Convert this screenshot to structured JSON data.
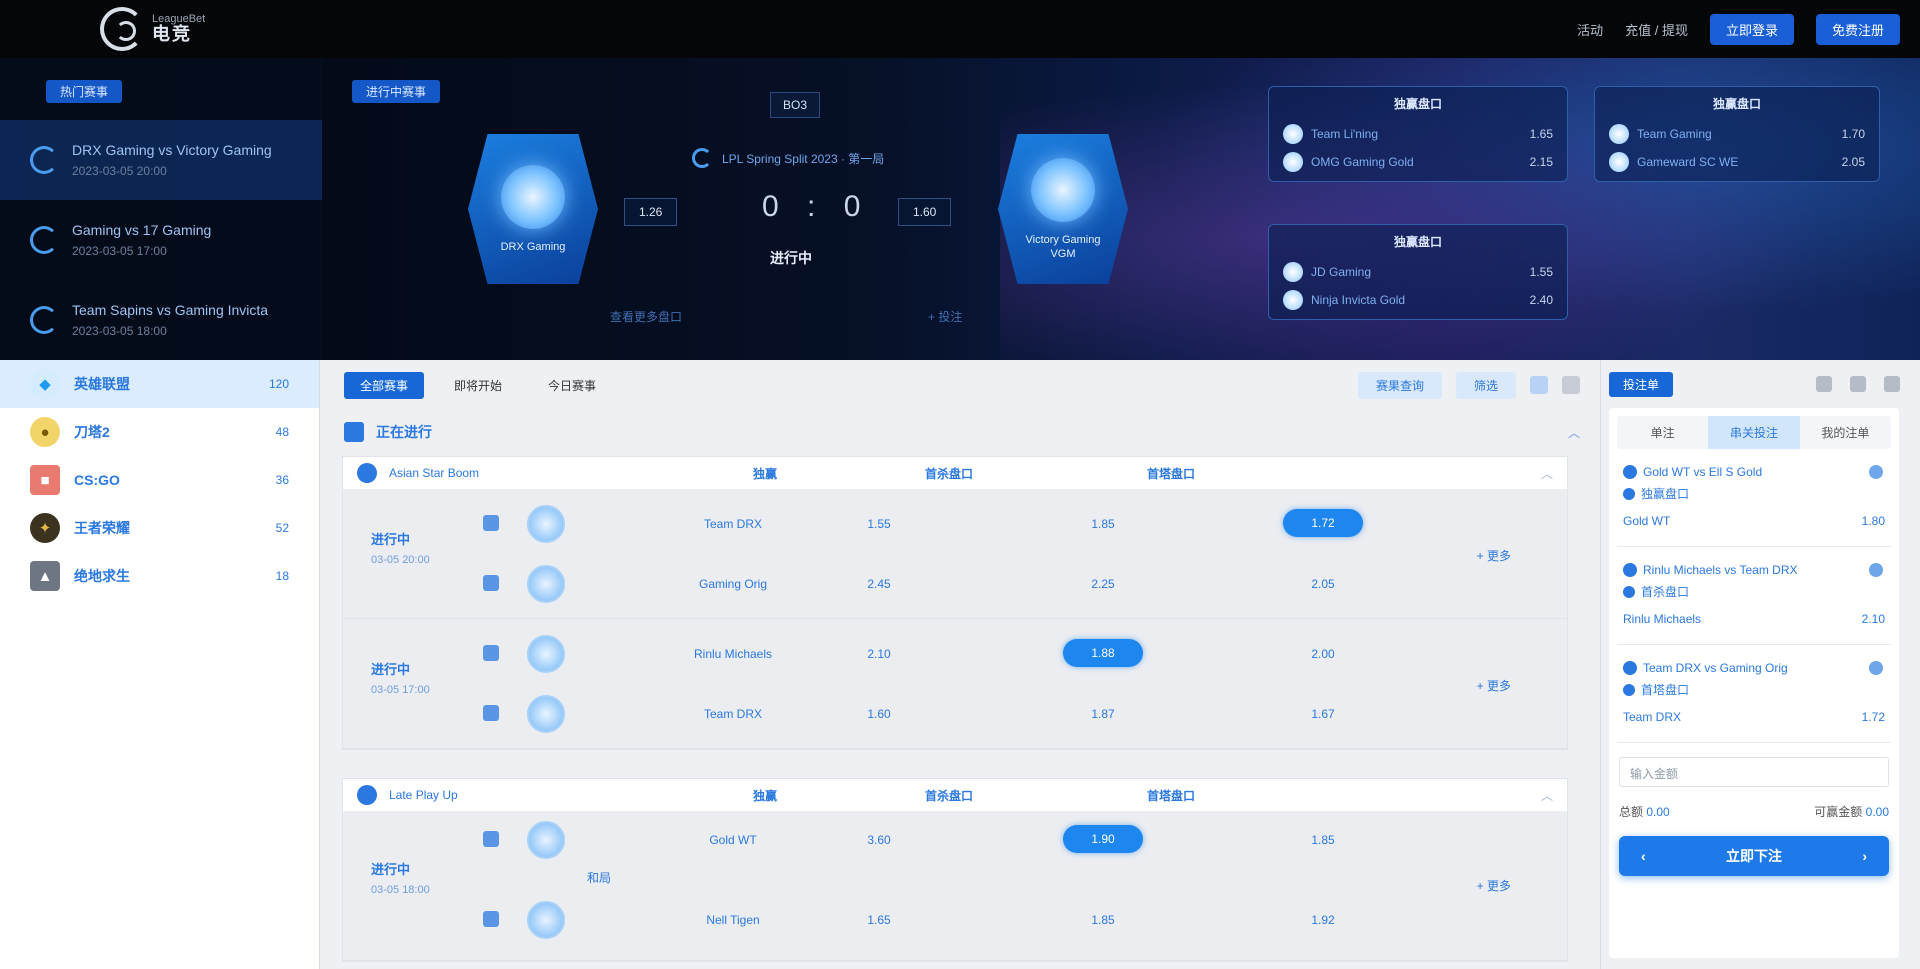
{
  "topbar": {
    "logo_en": "LeagueBet",
    "logo_cn": "电竞",
    "links": [
      "活动",
      "充值 / 提现"
    ],
    "login_label": "立即登录",
    "register_label": "免费注册"
  },
  "hero": {
    "left_pill": "热门赛事",
    "matches": [
      {
        "title": "DRX Gaming vs Victory Gaming",
        "sub": "2023-03-05 20:00"
      },
      {
        "title": "Gaming vs 17 Gaming",
        "sub": "2023-03-05 17:00"
      },
      {
        "title": "Team Sapins vs Gaming Invicta",
        "sub": "2023-03-05 18:00"
      }
    ],
    "center_pill": "进行中赛事",
    "round": "BO3",
    "league_text": "LPL Spring Split 2023 · 第一局",
    "home": {
      "name": "DRX Gaming",
      "odds": "1.26"
    },
    "away": {
      "name": "Victory Gaming",
      "name2": "VGM",
      "odds": "1.60"
    },
    "score": "0 : 0",
    "status": "进行中",
    "foot_left": "查看更多盘口",
    "foot_right": "+ 投注",
    "quick_cards": [
      {
        "title": "独赢盘口",
        "rows": [
          {
            "name": "Team Li'ning",
            "odds": "1.65"
          },
          {
            "name": "OMG Gaming Gold",
            "odds": "2.15"
          }
        ]
      },
      {
        "title": "独赢盘口",
        "rows": [
          {
            "name": "Team Gaming",
            "odds": "1.70"
          },
          {
            "name": "Gameward SC WE",
            "odds": "2.05"
          }
        ]
      },
      {
        "title": "独赢盘口",
        "rows": [
          {
            "name": "JD Gaming",
            "odds": "1.55"
          },
          {
            "name": "Ninja Invicta Gold",
            "odds": "2.40"
          }
        ]
      }
    ]
  },
  "sports": [
    {
      "label": "英雄联盟",
      "count": "120",
      "icon": "lol-icon",
      "color": "#1d9bf0"
    },
    {
      "label": "刀塔2",
      "count": "48",
      "icon": "dota-icon",
      "color": "#e3b21b"
    },
    {
      "label": "CS:GO",
      "count": "36",
      "icon": "csgo-icon",
      "color": "#d94b3d"
    },
    {
      "label": "王者荣耀",
      "count": "52",
      "icon": "kog-icon",
      "color": "#b8891c"
    },
    {
      "label": "绝地求生",
      "count": "18",
      "icon": "pubg-icon",
      "color": "#5e6775"
    }
  ],
  "main": {
    "tabs": [
      "全部赛事",
      "即将开始",
      "今日赛事"
    ],
    "tb_buttons": [
      "赛果查询",
      "筛选"
    ],
    "section_title": "正在进行",
    "leagues": [
      {
        "name": "Asian Star Boom",
        "cols": [
          "独赢",
          "首杀盘口",
          "首塔盘口"
        ],
        "matches": [
          {
            "time": "进行中",
            "sub": "03-05 20:00",
            "more": "+ 更多",
            "players": [
              {
                "name": "Team DRX",
                "odds": [
                  "1.55",
                  "1.85",
                  "1.72"
                ],
                "hi": 2
              },
              {
                "name": "Gaming Orig",
                "odds": [
                  "2.45",
                  "2.25",
                  "2.05"
                ],
                "hi": -1
              }
            ]
          },
          {
            "time": "进行中",
            "sub": "03-05 17:00",
            "more": "+ 更多",
            "players": [
              {
                "name": "Rinlu Michaels",
                "odds": [
                  "2.10",
                  "1.88",
                  "2.00"
                ],
                "hi": 1
              },
              {
                "name": "Team DRX",
                "odds": [
                  "1.60",
                  "1.87",
                  "1.67"
                ],
                "hi": -1
              }
            ]
          }
        ]
      },
      {
        "name": "Late Play Up",
        "cols": [
          "独赢",
          "首杀盘口",
          "首塔盘口"
        ],
        "matches": [
          {
            "time": "进行中",
            "sub": "03-05 18:00",
            "more": "+ 更多",
            "mid_label": "和局",
            "players": [
              {
                "name": "Gold WT",
                "odds": [
                  "3.60",
                  "1.90",
                  "1.85"
                ],
                "hi": 1
              },
              {
                "name": "Nell Tigen",
                "odds": [
                  "1.65",
                  "1.85",
                  "1.92"
                ],
                "hi": -1
              }
            ]
          }
        ]
      }
    ]
  },
  "slip": {
    "pill": "投注单",
    "tabs": [
      "单注",
      "串关投注",
      "我的注单"
    ],
    "bets": [
      {
        "match": "Gold WT vs Ell S Gold",
        "market": "独赢盘口",
        "sel": "Gold WT",
        "odds": "1.80"
      },
      {
        "match": "Rinlu Michaels vs Team DRX",
        "market": "首杀盘口",
        "sel": "Rinlu Michaels",
        "odds": "2.10"
      },
      {
        "match": "Team DRX vs Gaming Orig",
        "market": "首塔盘口",
        "sel": "Team DRX",
        "odds": "1.72"
      }
    ],
    "stake_placeholder": "输入金额",
    "total_label": "总额",
    "total_value": "0.00",
    "return_label": "可赢金额",
    "return_value": "0.00",
    "submit_label": "立即下注"
  }
}
